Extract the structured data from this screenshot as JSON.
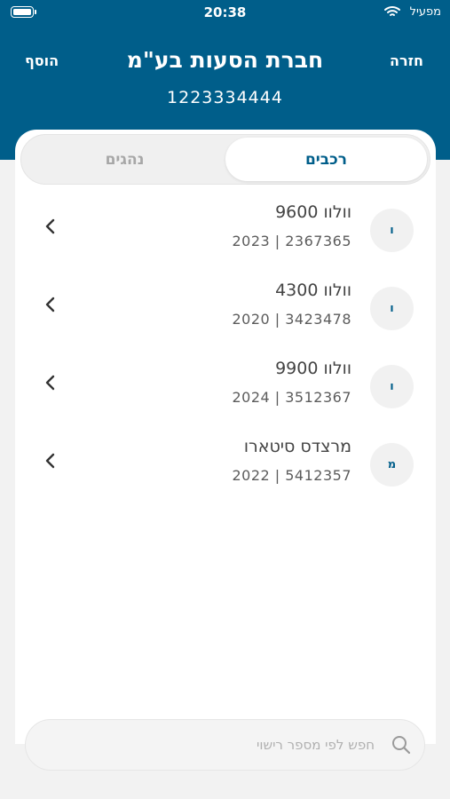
{
  "status_bar": {
    "time": "20:38",
    "carrier": "מפעיל"
  },
  "nav": {
    "add_label": "הוסף",
    "back_label": "חזרה"
  },
  "header": {
    "title": "חברת הסעות בע\"מ",
    "subtitle": "1223334444"
  },
  "tabs": [
    {
      "label": "רכבים",
      "active": true
    },
    {
      "label": "נהגים",
      "active": false
    }
  ],
  "vehicles": [
    {
      "initial": "ו",
      "name": "וולוו 9600",
      "details": "2023 | 2367365"
    },
    {
      "initial": "ו",
      "name": "וולוו 4300",
      "details": "2020 | 3423478"
    },
    {
      "initial": "ו",
      "name": "וולוו 9900",
      "details": "2024 | 3512367"
    },
    {
      "initial": "מ",
      "name": "מרצדס סיטארו",
      "details": "2022 | 5412357"
    }
  ],
  "search": {
    "placeholder": "חפש לפי מספר רישוי",
    "value": ""
  },
  "colors": {
    "primary": "#005e8a",
    "inactive_tab": "#a7a7a7",
    "avatar_bg": "#f1f1f1"
  },
  "icons": {
    "back": "chevron-left-icon",
    "search": "search-icon",
    "wifi": "wifi-icon",
    "battery": "battery-icon"
  }
}
